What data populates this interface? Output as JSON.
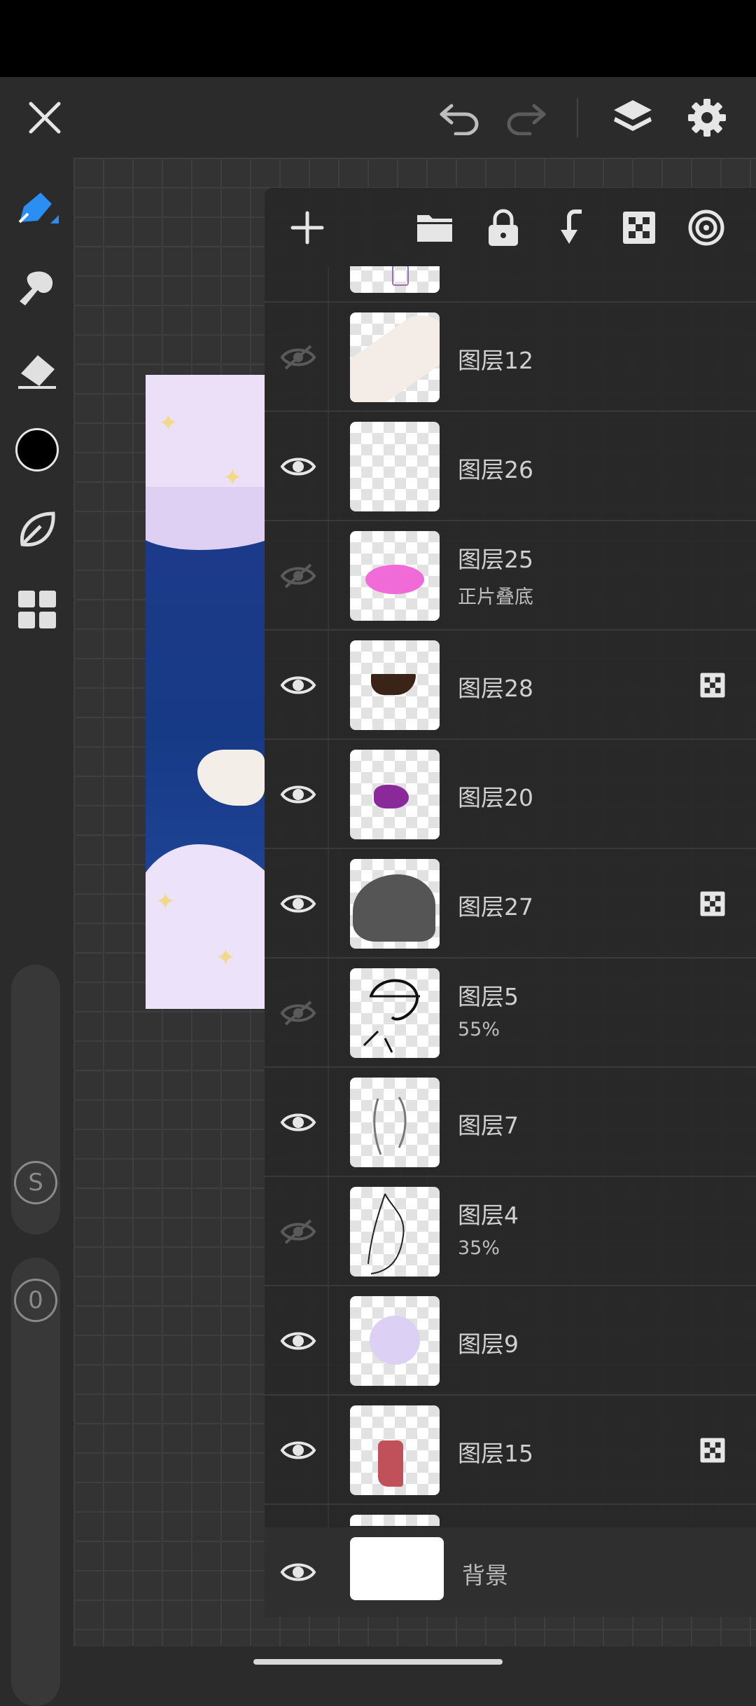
{
  "app": {
    "accent_color": "#2a8ef2",
    "top_icons": [
      "close-icon",
      "undo-icon",
      "redo-icon",
      "layers-icon",
      "settings-icon"
    ]
  },
  "sidebar": {
    "tools": [
      "pen-tool-icon",
      "brush-tool-icon",
      "eraser-icon",
      "color-swatch",
      "smudge-leaf-icon",
      "grid-menu-icon"
    ],
    "current_color": "#000000",
    "size_label": "S",
    "opacity_label": "0"
  },
  "layer_panel": {
    "toolbar_icons": [
      "add-layer-icon",
      "folder-icon",
      "lock-icon",
      "merge-down-icon",
      "alpha-lock-icon",
      "layer-mask-icon"
    ],
    "layers": [
      {
        "name": "图层12",
        "sub": "",
        "visible": false,
        "alpha_locked": false
      },
      {
        "name": "图层26",
        "sub": "",
        "visible": true,
        "alpha_locked": false
      },
      {
        "name": "图层25",
        "sub": "正片叠底",
        "visible": false,
        "alpha_locked": false
      },
      {
        "name": "图层28",
        "sub": "",
        "visible": true,
        "alpha_locked": true
      },
      {
        "name": "图层20",
        "sub": "",
        "visible": true,
        "alpha_locked": false
      },
      {
        "name": "图层27",
        "sub": "",
        "visible": true,
        "alpha_locked": true
      },
      {
        "name": "图层5",
        "sub": "55%",
        "visible": false,
        "alpha_locked": false
      },
      {
        "name": "图层7",
        "sub": "",
        "visible": true,
        "alpha_locked": false
      },
      {
        "name": "图层4",
        "sub": "35%",
        "visible": false,
        "alpha_locked": false
      },
      {
        "name": "图层9",
        "sub": "",
        "visible": true,
        "alpha_locked": false
      },
      {
        "name": "图层15",
        "sub": "",
        "visible": true,
        "alpha_locked": true
      }
    ],
    "background_layer": {
      "name": "背景",
      "visible": true
    }
  }
}
